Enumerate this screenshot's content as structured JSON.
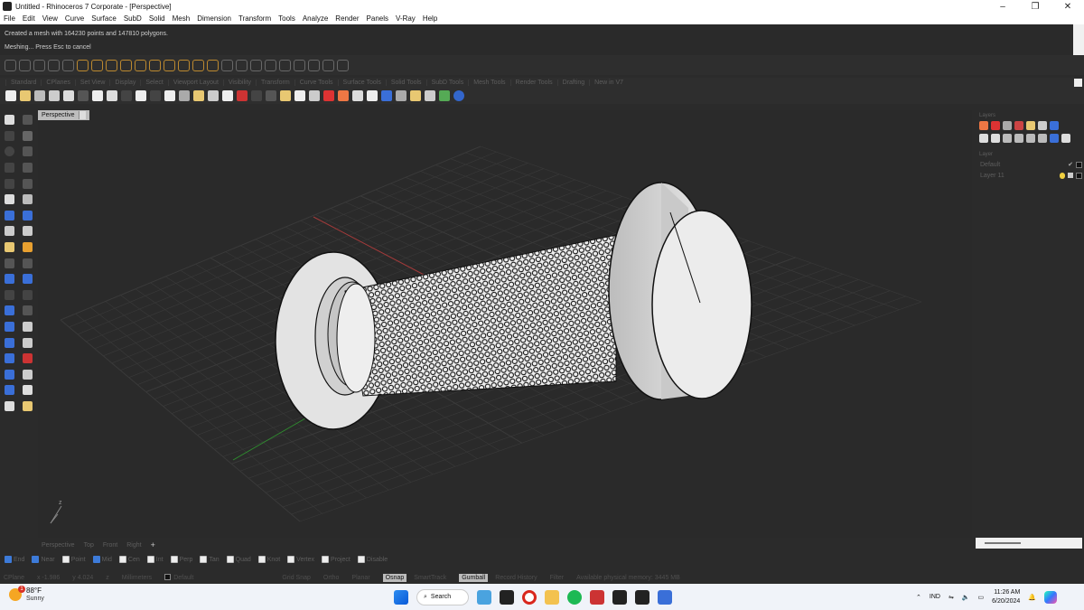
{
  "window": {
    "title": "Untitled - Rhinoceros 7 Corporate - [Perspective]",
    "controls": [
      "–",
      "❐",
      "✕"
    ]
  },
  "menu": [
    "File",
    "Edit",
    "View",
    "Curve",
    "Surface",
    "SubD",
    "Solid",
    "Mesh",
    "Dimension",
    "Transform",
    "Tools",
    "Analyze",
    "Render",
    "Panels",
    "V-Ray",
    "Help"
  ],
  "command_history": {
    "line1": "Created a mesh with 164230 points and 147810 polygons.",
    "line2": "Meshing... Press Esc to cancel"
  },
  "toolbar_tabs": [
    "Standard",
    "CPlanes",
    "Set View",
    "Display",
    "Select",
    "Viewport Layout",
    "Visibility",
    "Transform",
    "Curve Tools",
    "Surface Tools",
    "Solid Tools",
    "SubD Tools",
    "Mesh Tools",
    "Render Tools",
    "Drafting",
    "New in V7"
  ],
  "viewport": {
    "label": "Perspective",
    "axis_z": "z"
  },
  "view_tabs": [
    "Perspective",
    "Top",
    "Front",
    "Right"
  ],
  "add_view_label": "+",
  "layers_panel": {
    "title": "Layers",
    "column_header": "Layer",
    "layers": [
      {
        "name": "Default",
        "current": true
      },
      {
        "name": "Layer 11",
        "current": false
      }
    ]
  },
  "osnaps": [
    {
      "label": "End",
      "checked": true
    },
    {
      "label": "Near",
      "checked": true
    },
    {
      "label": "Point",
      "checked": false
    },
    {
      "label": "Mid",
      "checked": true
    },
    {
      "label": "Cen",
      "checked": false
    },
    {
      "label": "Int",
      "checked": false
    },
    {
      "label": "Perp",
      "checked": false
    },
    {
      "label": "Tan",
      "checked": false
    },
    {
      "label": "Quad",
      "checked": false
    },
    {
      "label": "Knot",
      "checked": false
    },
    {
      "label": "Vertex",
      "checked": false
    },
    {
      "label": "Project",
      "checked": false
    },
    {
      "label": "Disable",
      "checked": false
    }
  ],
  "status": {
    "cplane": "CPlane",
    "x": "x -1.986",
    "y": "y 4.024",
    "z": "z",
    "units": "Millimeters",
    "layer": "Default",
    "grid_snap": "Grid Snap",
    "ortho": "Ortho",
    "planar": "Planar",
    "osnap": "Osnap",
    "smarttrack": "SmartTrack",
    "gumball": "Gumball",
    "record_history": "Record History",
    "filter": "Filter",
    "memory": "Available physical memory: 3445 MB"
  },
  "taskbar": {
    "temperature": "88°F",
    "condition": "Sunny",
    "weather_badge": "1",
    "search_label": "Search",
    "language": "IND",
    "time": "11:26 AM",
    "date": "6/20/2024"
  },
  "colors": {
    "viewport_bg": "#2a2a2a",
    "grid": "#3a3a3a",
    "x_axis": "#a13a3a",
    "y_axis": "#2f8a2f",
    "osnap_active": "#3d7bd9"
  }
}
